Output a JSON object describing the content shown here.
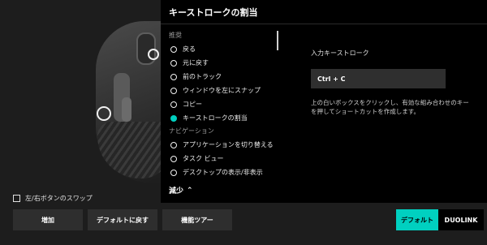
{
  "panel": {
    "title": "キーストロークの割当",
    "less_toggle": "減少"
  },
  "list": {
    "sections": [
      {
        "label": "推奨",
        "items": [
          {
            "label": "戻る",
            "selected": false
          },
          {
            "label": "元に戻す",
            "selected": false
          },
          {
            "label": "前のトラック",
            "selected": false
          },
          {
            "label": "ウィンドウを左にスナップ",
            "selected": false
          },
          {
            "label": "コピー",
            "selected": false
          },
          {
            "label": "キーストロークの割当",
            "selected": true
          }
        ]
      },
      {
        "label": "ナビゲーション",
        "items": [
          {
            "label": "アプリケーションを切り替える",
            "selected": false
          },
          {
            "label": "タスク ビュー",
            "selected": false
          },
          {
            "label": "デスクトップの表示/非表示",
            "selected": false
          }
        ]
      }
    ]
  },
  "right": {
    "input_label": "入力キーストローク",
    "keystroke_value": "Ctrl + C",
    "help": "上の白いボックスをクリックし、有効な組み合わせのキーを押してショートカットを作成します。"
  },
  "bottom": {
    "swap_label": "左/右ボタンのスワップ",
    "add": "増加",
    "reset": "デフォルトに戻す",
    "tour": "機能ツアー",
    "default": "デフォルト",
    "duolink": "DUOLINK"
  },
  "colors": {
    "accent": "#00d0c0",
    "panel_bg": "#000000",
    "app_bg": "#1d1d1d"
  }
}
